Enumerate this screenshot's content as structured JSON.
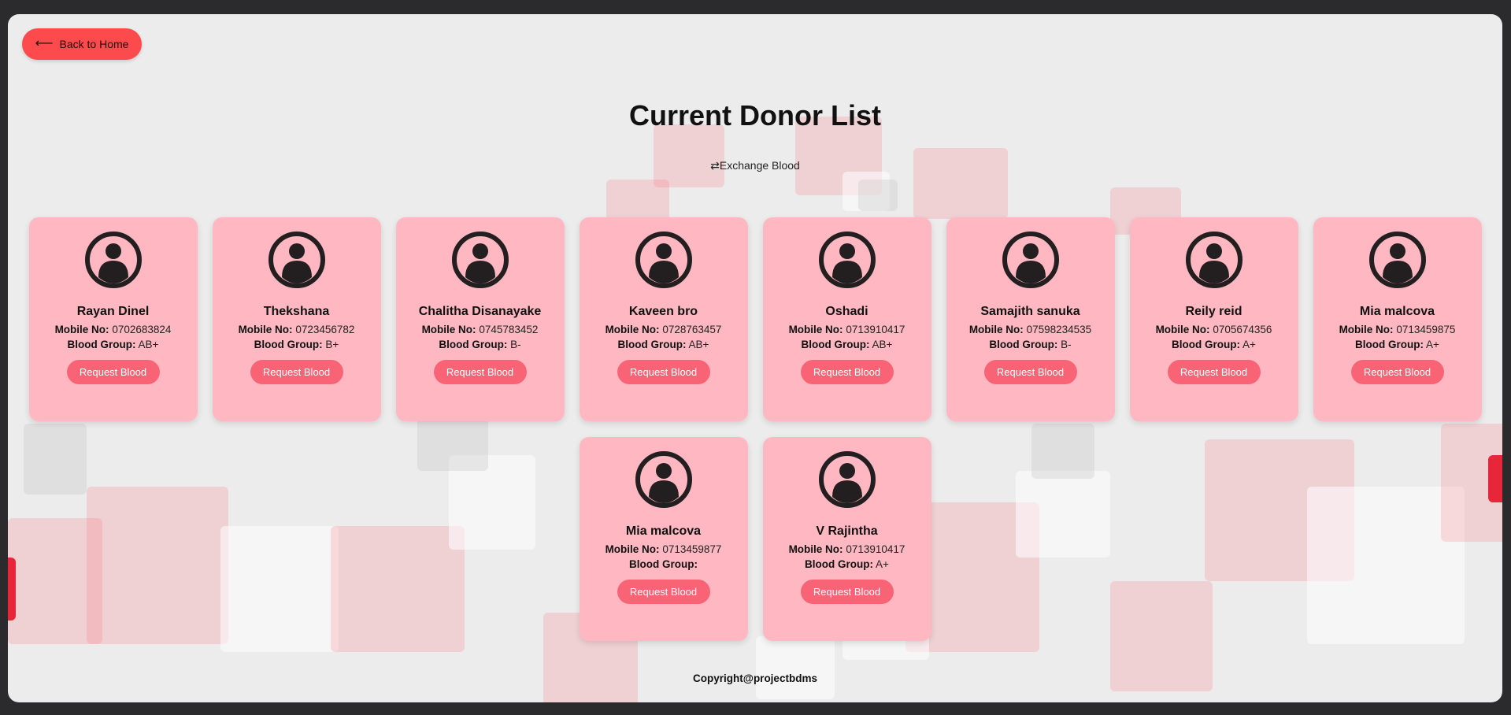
{
  "nav": {
    "back_label": "Back to Home",
    "back_icon": "left-arrow-icon"
  },
  "page": {
    "title": "Current Donor List",
    "exchange_icon": "⇄",
    "exchange_label": "Exchange Blood"
  },
  "labels": {
    "mobile": "Mobile No:",
    "blood_group": "Blood Group:",
    "request": "Request Blood"
  },
  "donors": [
    {
      "name": "Rayan Dinel",
      "mobile": "0702683824",
      "blood_group": "AB+"
    },
    {
      "name": "Thekshana",
      "mobile": "0723456782",
      "blood_group": "B+"
    },
    {
      "name": "Chalitha Disanayake",
      "mobile": "0745783452",
      "blood_group": "B-"
    },
    {
      "name": "Kaveen bro",
      "mobile": "0728763457",
      "blood_group": "AB+"
    },
    {
      "name": "Oshadi",
      "mobile": "0713910417",
      "blood_group": "AB+"
    },
    {
      "name": "Samajith sanuka",
      "mobile": "07598234535",
      "blood_group": "B-"
    },
    {
      "name": "Reily reid",
      "mobile": "0705674356",
      "blood_group": "A+"
    },
    {
      "name": "Mia malcova",
      "mobile": "0713459875",
      "blood_group": "A+"
    },
    {
      "name": "Mia malcova",
      "mobile": "0713459877",
      "blood_group": ""
    },
    {
      "name": "V Rajintha",
      "mobile": "0713910417",
      "blood_group": "A+"
    }
  ],
  "footer": {
    "copyright": "Copyright@projectbdms"
  },
  "colors": {
    "back_button": "#fc4a4d",
    "card": "#ffb8c1",
    "request_button": "#f86475"
  }
}
